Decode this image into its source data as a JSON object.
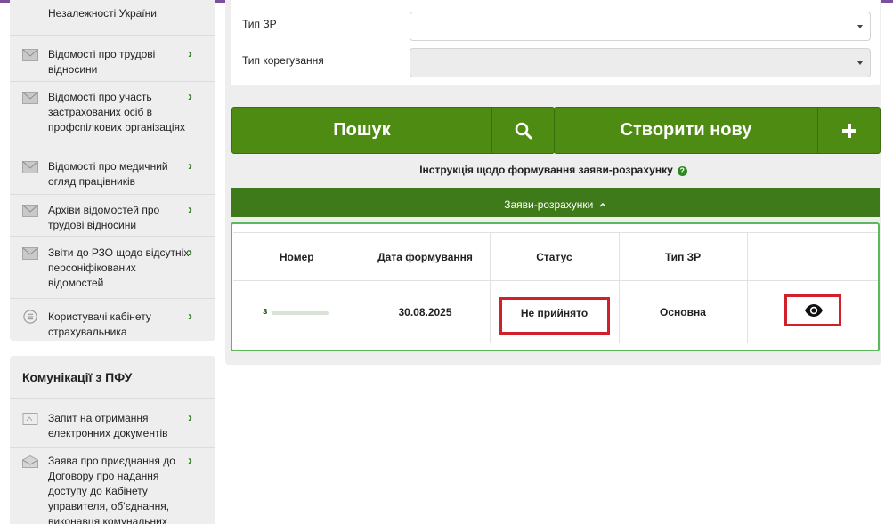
{
  "sidebar": {
    "top_text": "Незалежності України",
    "items": [
      {
        "label": "Відомості про трудові відносини",
        "icon": "envelope-icon"
      },
      {
        "label": "Відомості про участь застрахованих осіб в профспілкових організаціях",
        "icon": "envelope-icon"
      },
      {
        "label": "Відомості про медичний огляд працівників",
        "icon": "envelope-icon"
      },
      {
        "label": "Архіви відомостей про трудові відносини",
        "icon": "envelope-icon"
      },
      {
        "label": "Звіти до РЗО щодо відсутніх персоніфікованих відомостей",
        "icon": "envelope-icon"
      },
      {
        "label": "Користувачі кабінету страхувальника",
        "icon": "list-circle-icon"
      }
    ],
    "comm_section": {
      "heading": "Комунікації з ПФУ",
      "items": [
        {
          "label": "Запит на отримання електронних документів",
          "icon": "document-icon"
        },
        {
          "label": "Заява про приєднання до Договору про надання доступу до Кабінету управителя, об'єднання, виконавця комунальних",
          "icon": "envelope-open-icon"
        }
      ]
    }
  },
  "form": {
    "type_label": "Тип ЗР",
    "type_value": "",
    "correction_label": "Тип корегування",
    "correction_value": ""
  },
  "buttons": {
    "search_label": "Пошук",
    "search_icon": "search-icon",
    "create_label": "Створити нову",
    "create_icon": "plus-icon"
  },
  "instruction": {
    "text": "Інструкція щодо формування заяви-розрахунку",
    "icon": "question-circle-icon"
  },
  "section": {
    "title": "Заяви-розрахунки",
    "icon": "chevron-up-icon"
  },
  "table": {
    "headers": [
      "Номер",
      "Дата формування",
      "Статус",
      "Тип ЗР",
      ""
    ],
    "rows": [
      {
        "number": "з",
        "date": "30.08.2025",
        "status": "Не прийнято",
        "type": "Основна",
        "action_icon": "eye-icon"
      }
    ]
  },
  "colors": {
    "accent_green": "#4e8b12",
    "section_green": "#3f7a1a",
    "link_green": "#2e7d1f",
    "highlight_red": "#d0202a",
    "top_bar_purple": "#7b4f9d"
  }
}
